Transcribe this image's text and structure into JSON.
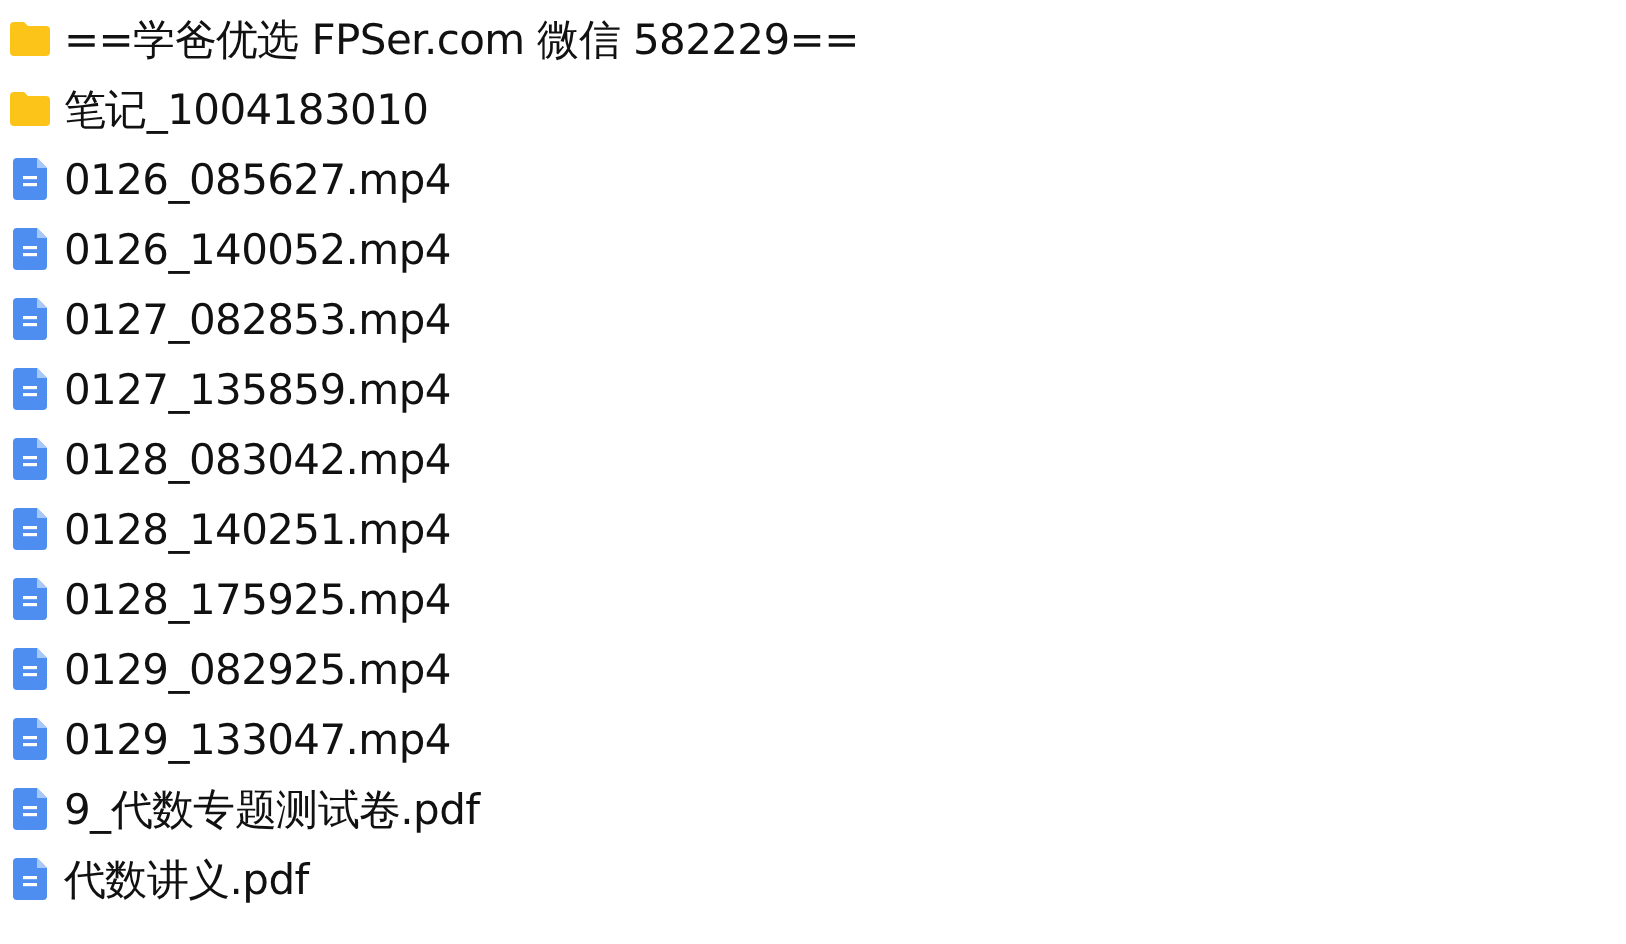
{
  "files": [
    {
      "kind": "folder",
      "name": "==学爸优选 FPSer.com 微信 582229=="
    },
    {
      "kind": "folder",
      "name": "笔记_1004183010"
    },
    {
      "kind": "file",
      "name": "0126_085627.mp4"
    },
    {
      "kind": "file",
      "name": "0126_140052.mp4"
    },
    {
      "kind": "file",
      "name": "0127_082853.mp4"
    },
    {
      "kind": "file",
      "name": "0127_135859.mp4"
    },
    {
      "kind": "file",
      "name": "0128_083042.mp4"
    },
    {
      "kind": "file",
      "name": "0128_140251.mp4"
    },
    {
      "kind": "file",
      "name": "0128_175925.mp4"
    },
    {
      "kind": "file",
      "name": "0129_082925.mp4"
    },
    {
      "kind": "file",
      "name": "0129_133047.mp4"
    },
    {
      "kind": "file",
      "name": "9_代数专题测试卷.pdf"
    },
    {
      "kind": "file",
      "name": "代数讲义.pdf"
    }
  ]
}
